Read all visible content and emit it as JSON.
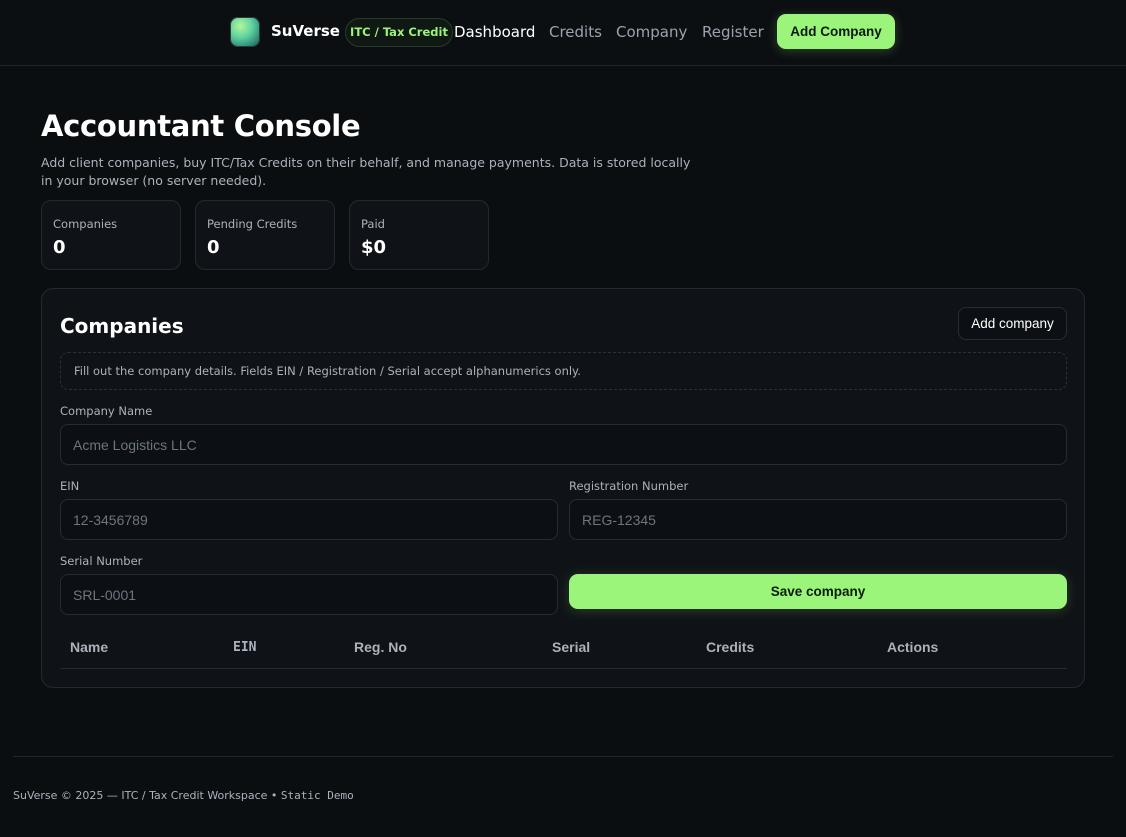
{
  "header": {
    "brand_name": "SuVerse",
    "brand_icon": "brand-logo-icon",
    "badge": "ITC / Tax Credit",
    "nav": [
      {
        "label": "Dashboard",
        "active": true
      },
      {
        "label": "Credits",
        "active": false
      },
      {
        "label": "Company",
        "active": false
      },
      {
        "label": "Register",
        "active": false
      }
    ],
    "cta_label": "Add Company"
  },
  "main": {
    "title": "Accountant Console",
    "subtitle": "Add client companies, buy ITC/Tax Credits on their behalf, and manage payments. Data is stored locally in your browser (no server needed).",
    "stats": [
      {
        "label": "Companies",
        "value": "0"
      },
      {
        "label": "Pending Credits",
        "value": "0"
      },
      {
        "label": "Paid",
        "value": "$0"
      }
    ]
  },
  "companies": {
    "title": "Companies",
    "add_button": "Add company",
    "notice": "Fill out the company details. Fields EIN / Registration / Serial accept alphanumerics only.",
    "form": {
      "company_name_label": "Company Name",
      "company_name_placeholder": "Acme Logistics LLC",
      "ein_label": "EIN",
      "ein_placeholder": "12-3456789",
      "reg_label": "Registration Number",
      "reg_placeholder": "REG-12345",
      "serial_label": "Serial Number",
      "serial_placeholder": "SRL-0001",
      "save_label": "Save company"
    },
    "table": {
      "columns": [
        "Name",
        "EIN",
        "Reg. No",
        "Serial",
        "Credits",
        "Actions"
      ],
      "rows": []
    }
  },
  "footer": {
    "text": "SuVerse © 2025 — ITC / Tax Credit Workspace • ",
    "tag": "Static Demo"
  },
  "colors": {
    "background": "#0b0e11",
    "accent": "#9af57a",
    "panel": "#0f1317",
    "border": "#232a31"
  }
}
